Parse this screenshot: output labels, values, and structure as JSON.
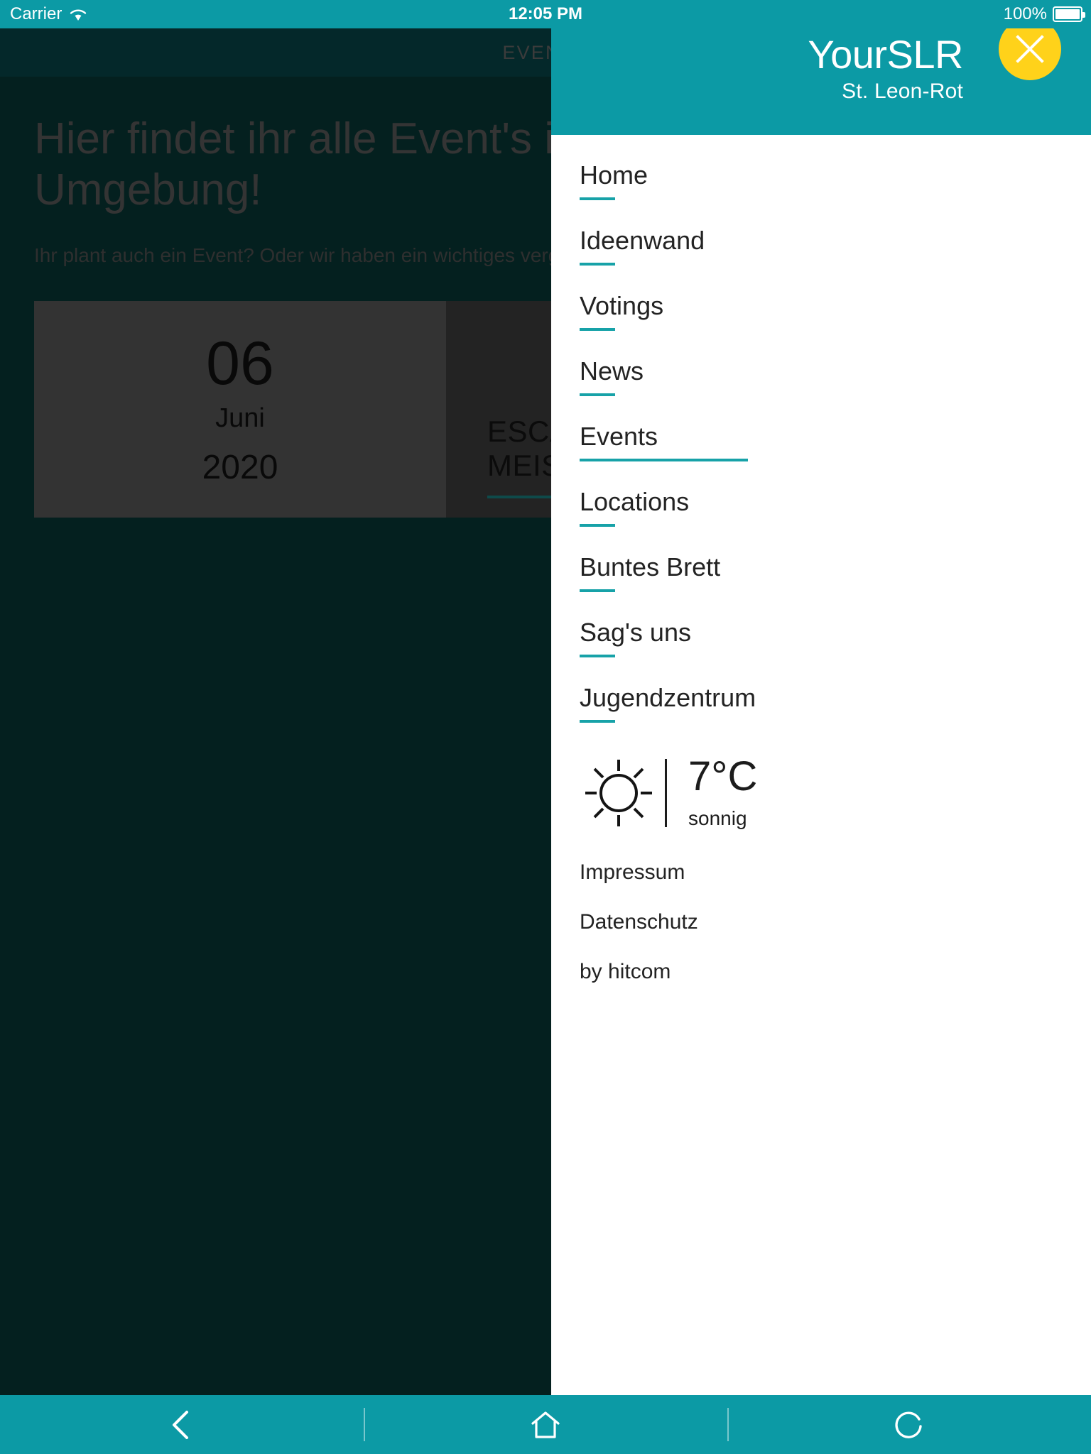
{
  "status_bar": {
    "carrier": "Carrier",
    "time": "12:05 PM",
    "battery": "100%",
    "wifi_icon": "wifi-icon",
    "battery_icon": "battery-icon"
  },
  "app_bar": {
    "title": "EVENTS"
  },
  "page": {
    "headline": "Hier findet ihr alle Event's in Umgebung!",
    "subline": "Ihr plant auch ein Event? Oder wir haben ein wichtiges vergessen?",
    "event_card": {
      "day": "06",
      "month": "Juni",
      "year": "2020",
      "title": "ESCAPE-ROOM MEISTERSCHAFT"
    }
  },
  "drawer": {
    "brand_title": "YourSLR",
    "brand_subtitle": "St. Leon-Rot",
    "close_icon": "close-icon",
    "menu": [
      {
        "label": "Home",
        "active": false
      },
      {
        "label": "Ideenwand",
        "active": false
      },
      {
        "label": "Votings",
        "active": false
      },
      {
        "label": "News",
        "active": false
      },
      {
        "label": "Events",
        "active": true
      },
      {
        "label": "Locations",
        "active": false
      },
      {
        "label": "Buntes Brett",
        "active": false
      },
      {
        "label": "Sag's uns",
        "active": false
      },
      {
        "label": "Jugendzentrum",
        "active": false
      }
    ],
    "weather": {
      "icon": "sun-icon",
      "temperature": "7°C",
      "description": "sonnig"
    },
    "footer": [
      {
        "label": "Impressum"
      },
      {
        "label": "Datenschutz"
      },
      {
        "label": "by hitcom"
      }
    ]
  },
  "toolbar": {
    "back_icon": "chevron-left-icon",
    "home_icon": "home-icon",
    "reload_icon": "reload-icon"
  },
  "colors": {
    "accent_teal": "#0c9aa5",
    "rule_teal": "#17a2a8",
    "close_yellow": "#ffd21a",
    "drawer_bg": "#ffffff",
    "content_bg": "#04201f"
  }
}
